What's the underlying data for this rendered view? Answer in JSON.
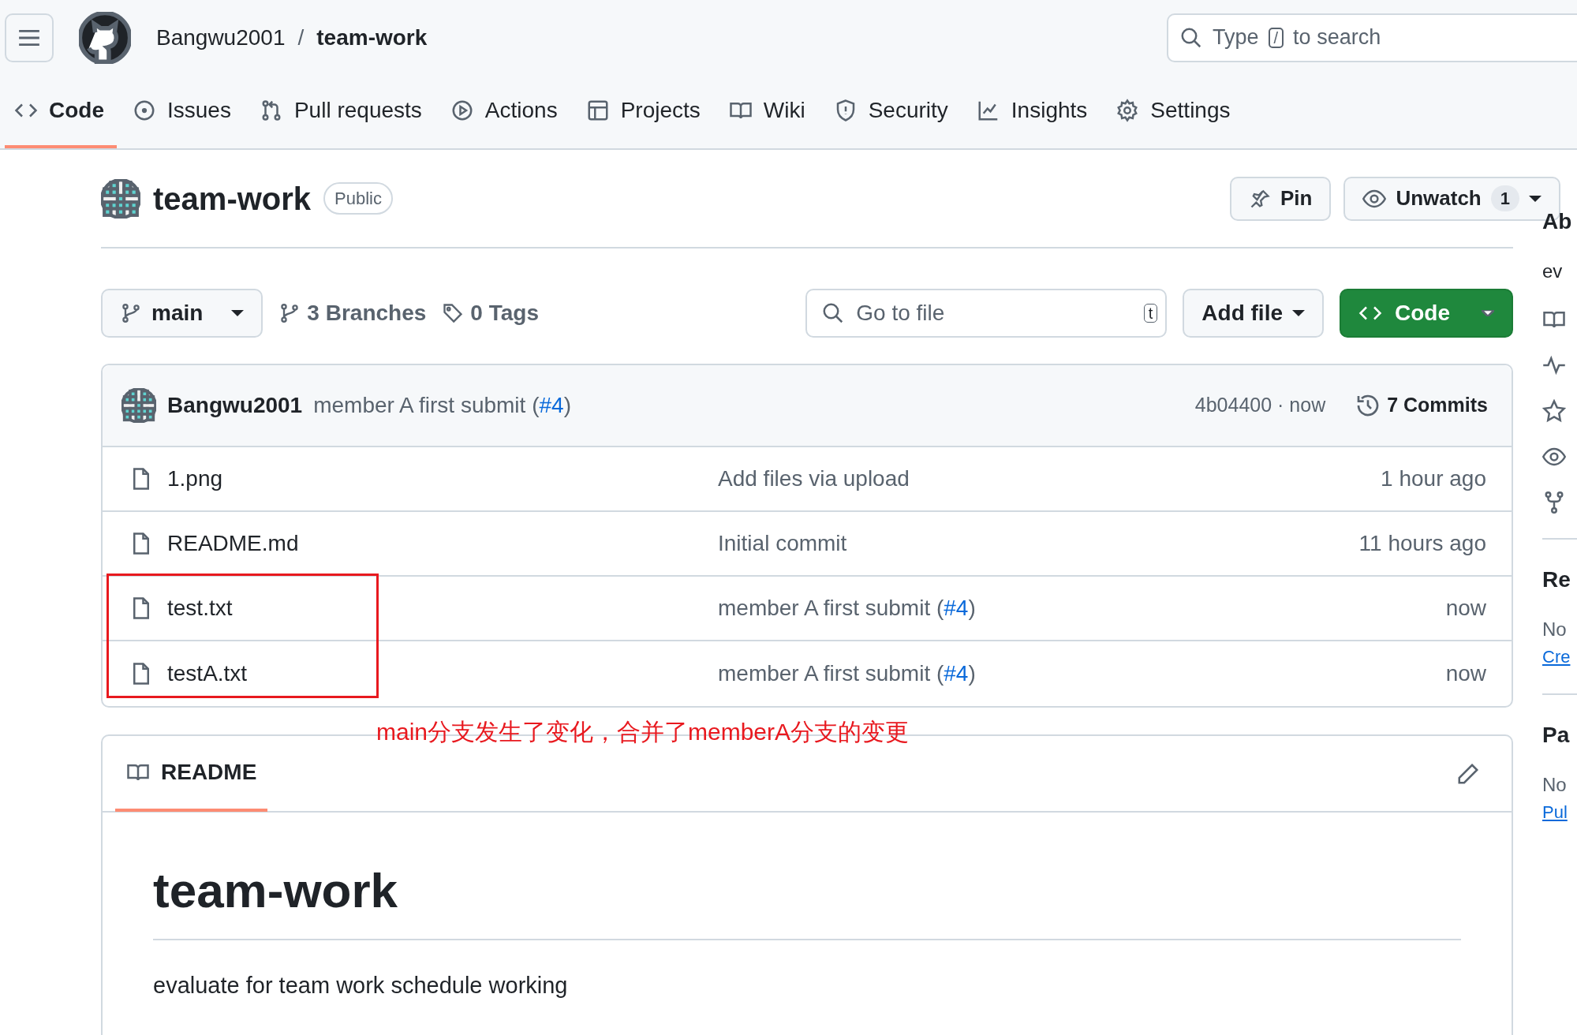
{
  "header": {
    "owner": "Bangwu2001",
    "separator": "/",
    "repo": "team-work",
    "search": {
      "before": "Type",
      "key": "/",
      "after": "to search"
    }
  },
  "tabs": [
    {
      "label": "Code",
      "selected": true
    },
    {
      "label": "Issues",
      "selected": false
    },
    {
      "label": "Pull requests",
      "selected": false
    },
    {
      "label": "Actions",
      "selected": false
    },
    {
      "label": "Projects",
      "selected": false
    },
    {
      "label": "Wiki",
      "selected": false
    },
    {
      "label": "Security",
      "selected": false
    },
    {
      "label": "Insights",
      "selected": false
    },
    {
      "label": "Settings",
      "selected": false
    }
  ],
  "repo": {
    "name": "team-work",
    "visibility": "Public",
    "pin": "Pin",
    "watch": "Unwatch",
    "watch_count": "1"
  },
  "toolbar": {
    "branch": "main",
    "branches": "3 Branches",
    "tags": "0 Tags",
    "go_to_file": {
      "placeholder": "Go to file",
      "key": "t"
    },
    "add_file": "Add file",
    "code": "Code"
  },
  "latest_commit": {
    "author": "Bangwu2001",
    "message": "member A first submit (",
    "link": "#4",
    "message_end": ")",
    "hash_time": "4b04400 · now",
    "commits": "7 Commits"
  },
  "files": [
    {
      "name": "1.png",
      "message": "Add files via upload",
      "time": "1 hour ago",
      "annotated": false
    },
    {
      "name": "README.md",
      "message": "Initial commit",
      "time": "11 hours ago",
      "annotated": false
    },
    {
      "name": "test.txt",
      "message": "member A first submit (",
      "link": "#4",
      "message_end": ")",
      "time": "now",
      "annotated": true
    },
    {
      "name": "testA.txt",
      "message": "member A first submit (",
      "link": "#4",
      "message_end": ")",
      "time": "now",
      "annotated": true
    }
  ],
  "annotation": {
    "text": "main分支发生了变化，合并了memberA分支的变更"
  },
  "readme": {
    "tab": "README",
    "heading": "team-work",
    "text": "evaluate for team work schedule working"
  },
  "sidebar": {
    "about": "Ab",
    "description": "ev",
    "releases": "Re",
    "releases_text": "No",
    "releases_link": "Cre",
    "packages": "Pa",
    "packages_text": "No",
    "packages_link": "Pul"
  }
}
